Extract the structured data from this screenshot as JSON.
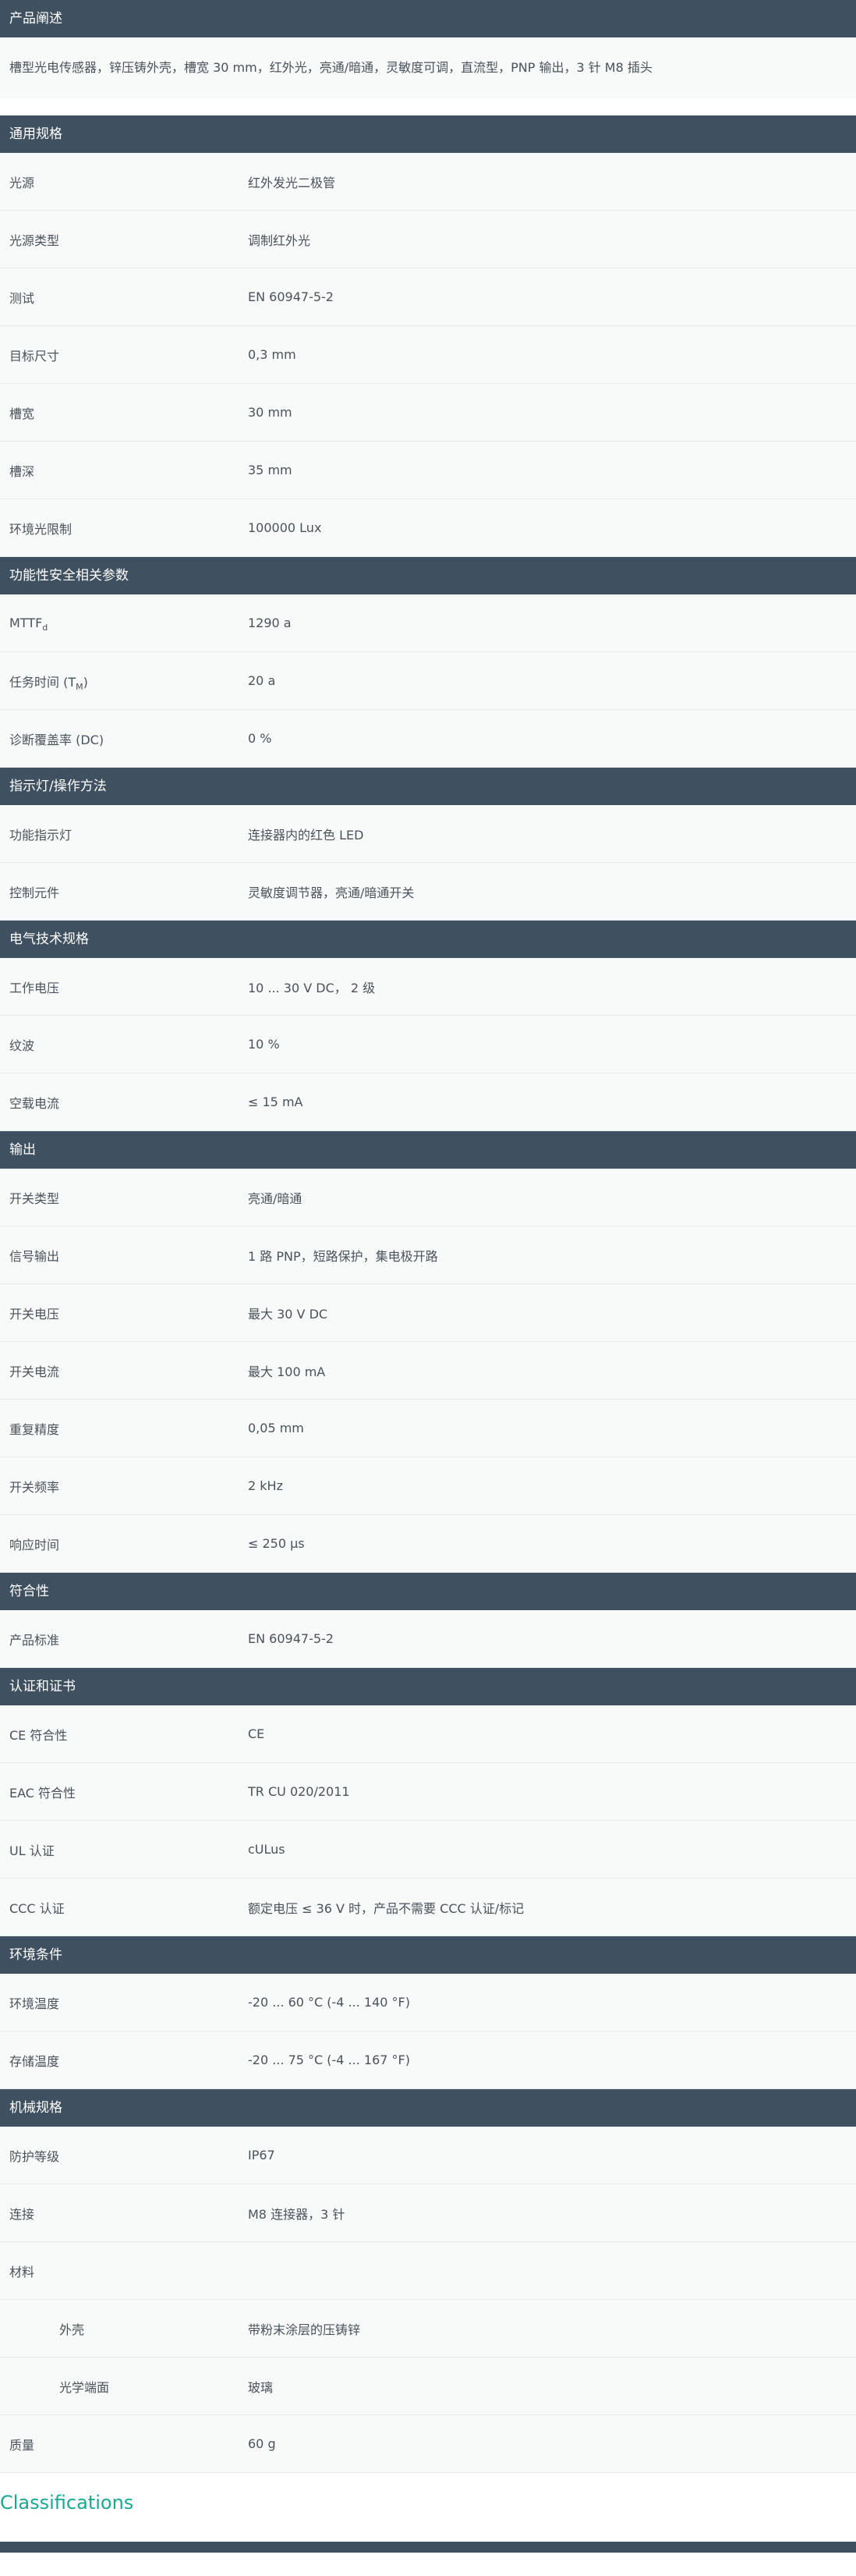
{
  "description": {
    "header": "产品阐述",
    "text": "槽型光电传感器，锌压铸外壳，槽宽 30 mm，红外光，亮通/暗通，灵敏度可调，直流型，PNP 输出，3 针 M8 插头"
  },
  "general": {
    "header": "通用规格",
    "rows": [
      {
        "label": "光源",
        "value": "红外发光二极管"
      },
      {
        "label": "光源类型",
        "value": "调制红外光"
      },
      {
        "label": "测试",
        "value": "EN 60947-5-2"
      },
      {
        "label": "目标尺寸",
        "value": "0,3 mm"
      },
      {
        "label": "槽宽",
        "value": "30 mm"
      },
      {
        "label": "槽深",
        "value": "35 mm"
      },
      {
        "label": "环境光限制",
        "value": "100000 Lux"
      }
    ]
  },
  "safety": {
    "header": "功能性安全相关参数",
    "rows": [
      {
        "label_main": "MTTF",
        "label_sub": "d",
        "label_suffix": "",
        "value": "1290 a"
      },
      {
        "label_main": "任务时间 (T",
        "label_sub": "M",
        "label_suffix": ")",
        "value": "20 a"
      },
      {
        "label_main": "诊断覆盖率 (DC)",
        "label_sub": "",
        "label_suffix": "",
        "value": "0 %"
      }
    ]
  },
  "indicators": {
    "header": "指示灯/操作方法",
    "rows": [
      {
        "label": "功能指示灯",
        "value": "连接器内的红色 LED"
      },
      {
        "label": "控制元件",
        "value": "灵敏度调节器，亮通/暗通开关"
      }
    ]
  },
  "electrical": {
    "header": "电气技术规格",
    "rows": [
      {
        "label": "工作电压",
        "value": "10 ... 30 V DC， 2 级"
      },
      {
        "label": "纹波",
        "value": "10 %"
      },
      {
        "label": "空载电流",
        "value": "≤ 15 mA"
      }
    ]
  },
  "output": {
    "header": "输出",
    "rows": [
      {
        "label": "开关类型",
        "value": "亮通/暗通"
      },
      {
        "label": "信号输出",
        "value": "1 路 PNP，短路保护，集电极开路"
      },
      {
        "label": "开关电压",
        "value": "最大 30 V DC"
      },
      {
        "label": "开关电流",
        "value": "最大 100 mA"
      },
      {
        "label": "重复精度",
        "value": "0,05 mm"
      },
      {
        "label": "开关频率",
        "value": "2 kHz"
      },
      {
        "label": "响应时间",
        "value": "≤ 250 µs"
      }
    ]
  },
  "conformity": {
    "header": "符合性",
    "rows": [
      {
        "label": "产品标准",
        "value": "EN 60947-5-2"
      }
    ]
  },
  "approvals": {
    "header": "认证和证书",
    "rows": [
      {
        "label": "CE 符合性",
        "value": "CE"
      },
      {
        "label": "EAC 符合性",
        "value": "TR CU 020/2011"
      },
      {
        "label": "UL 认证",
        "value": "cULus"
      },
      {
        "label": "CCC 认证",
        "value": "额定电压 ≤ 36 V 时，产品不需要 CCC 认证/标记"
      }
    ]
  },
  "ambient": {
    "header": "环境条件",
    "rows": [
      {
        "label": "环境温度",
        "value": "-20 ... 60 °C (-4 ... 140 °F)"
      },
      {
        "label": "存储温度",
        "value": "-20 ... 75 °C (-4 ... 167 °F)"
      }
    ]
  },
  "mechanical": {
    "header": "机械规格",
    "rows": [
      {
        "label": "防护等级",
        "value": "IP67"
      },
      {
        "label": "连接",
        "value": "M8 连接器，3 针"
      },
      {
        "label": "材料",
        "value": ""
      },
      {
        "label": "外壳",
        "value": "带粉末涂层的压铸锌"
      },
      {
        "label": "光学端面",
        "value": "玻璃"
      },
      {
        "label": "质量",
        "value": "60 g"
      }
    ]
  },
  "classifications": {
    "title": "Classifications"
  }
}
